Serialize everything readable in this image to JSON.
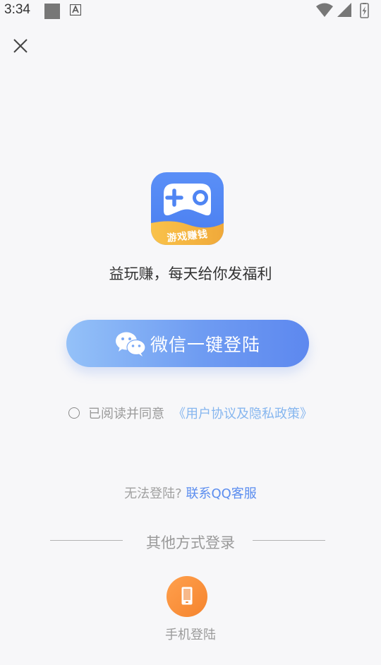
{
  "status_bar": {
    "time": "3:34",
    "icons": [
      "notification-square-icon",
      "a-icon",
      "wifi-icon",
      "signal-icon",
      "battery-charging-icon"
    ]
  },
  "close_icon": "close-icon",
  "app_icon": {
    "label": "游戏赚钱",
    "icon": "gamepad-icon"
  },
  "slogan": "益玩赚，每天给你发福利",
  "wechat_login": {
    "label": "微信一键登陆",
    "icon": "wechat-icon"
  },
  "agreement": {
    "text": "已阅读并同意",
    "link": "《用户协议及隐私政策》"
  },
  "trouble": {
    "text": "无法登陆?",
    "link": "联系QQ客服"
  },
  "other_methods": {
    "label": "其他方式登录"
  },
  "phone_login": {
    "label": "手机登陆",
    "icon": "phone-icon"
  },
  "colors": {
    "button_start": "#94c1f8",
    "button_end": "#5d88ef",
    "link_blue": "#5b8def",
    "agreement_link": "#86b6ef",
    "phone_orange": "#f5842e"
  }
}
